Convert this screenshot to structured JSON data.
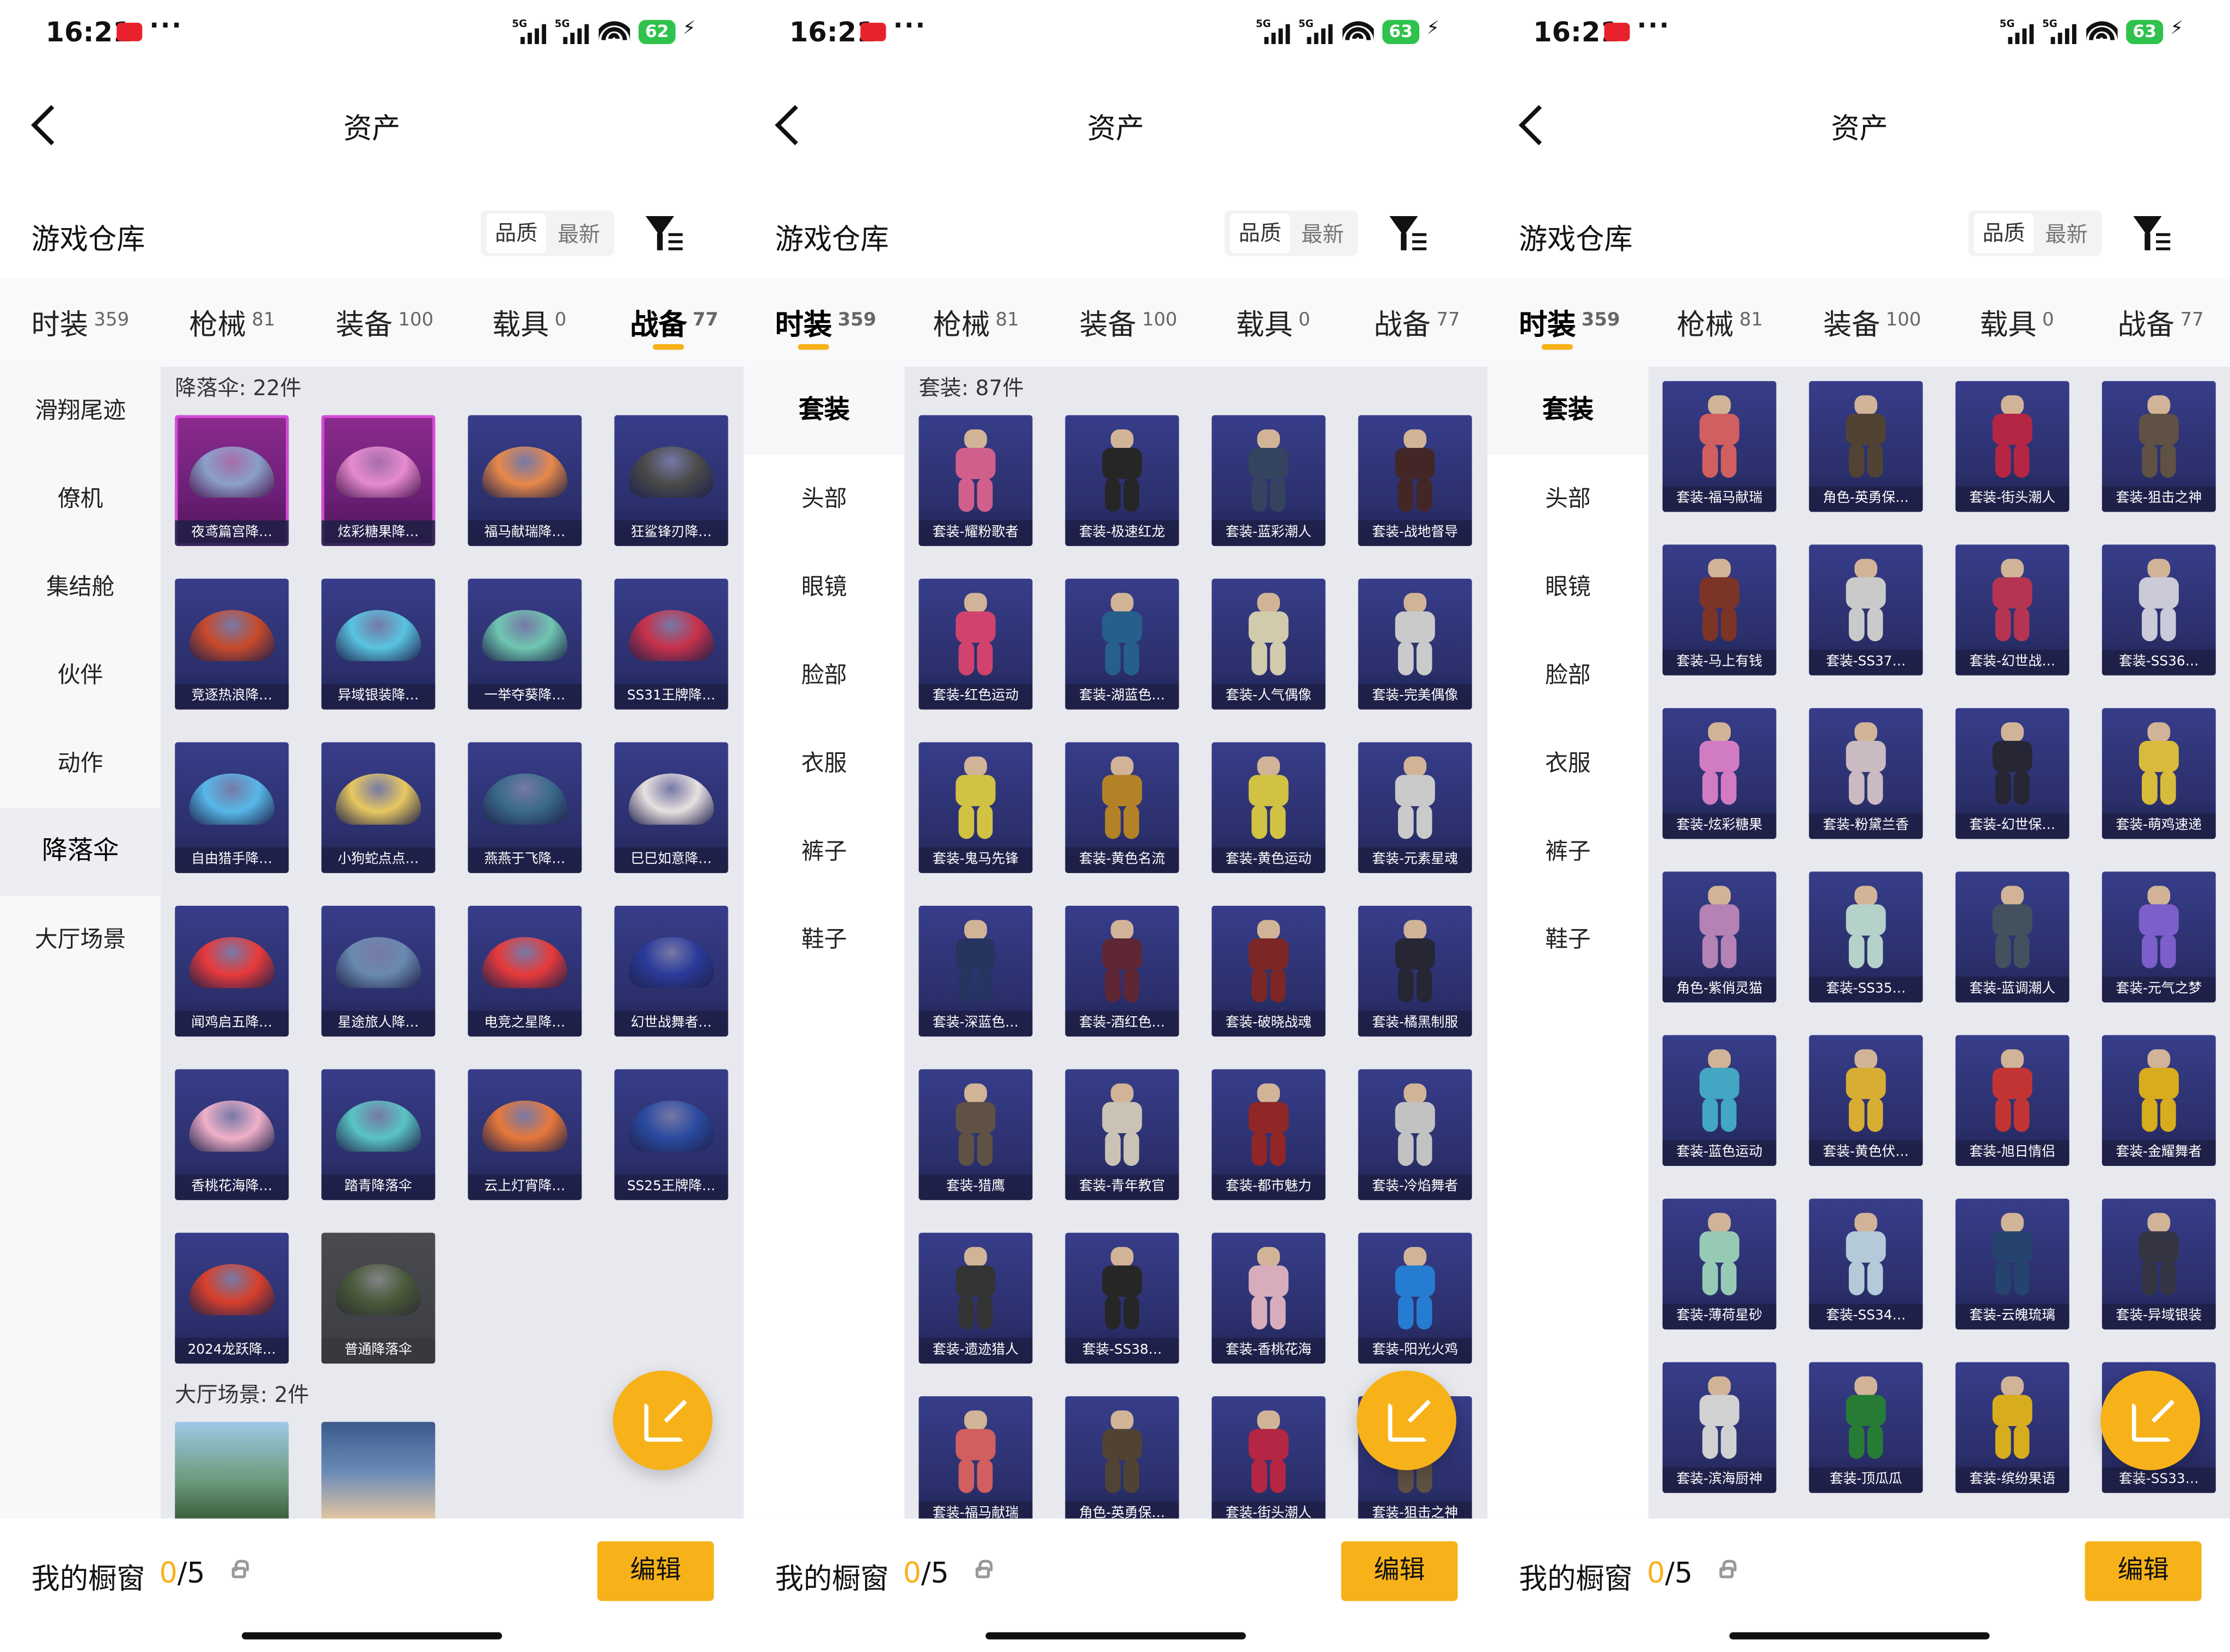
{
  "status": {
    "time": "16:21",
    "dots": "···",
    "net": "5G",
    "batteries": [
      "62",
      "63",
      "63"
    ]
  },
  "nav": {
    "title": "资产"
  },
  "warehouse": {
    "title": "游戏仓库",
    "sort_quality": "品质",
    "sort_newest": "最新"
  },
  "tabs": [
    {
      "label": "时装",
      "count": "359"
    },
    {
      "label": "枪械",
      "count": "81"
    },
    {
      "label": "装备",
      "count": "100"
    },
    {
      "label": "载具",
      "count": "0"
    },
    {
      "label": "战备",
      "count": "77"
    }
  ],
  "panel1": {
    "active_tab": 4,
    "sidebar": [
      "滑翔尾迹",
      "僚机",
      "集结舱",
      "伙伴",
      "动作",
      "降落伞",
      "大厅场景"
    ],
    "active_side": 5,
    "section1": "降落伞: 22件",
    "section2": "大厅场景: 2件",
    "items": [
      "夜鸢篇宫降…",
      "炫彩糖果降…",
      "福马献瑞降…",
      "狂鲨锋刃降…",
      "竞逐热浪降…",
      "异域银装降…",
      "一举夺葵降…",
      "SS31王牌降…",
      "自由猎手降…",
      "小狗蛇点点…",
      "燕燕于飞降…",
      "巳巳如意降…",
      "闻鸡启五降…",
      "星途旅人降…",
      "电竞之星降…",
      "幻世战舞者…",
      "香桃花海降…",
      "踏青降落伞",
      "云上灯宵降…",
      "SS25王牌降…",
      "2024龙跃降…",
      "普通降落伞"
    ],
    "item_colors": [
      "#8aa0c8",
      "#e68bd0",
      "#e8884a",
      "#4a4a48",
      "#c84a2a",
      "#59c4e0",
      "#6fc7b0",
      "#c8314a",
      "#57b8e8",
      "#e8c860",
      "#3a6a8a",
      "#e8e0e0",
      "#e83a3a",
      "#6a8ab0",
      "#e83a3a",
      "#2a3a9a",
      "#f0b0c8",
      "#59c4c4",
      "#e8783a",
      "#2a4aa0",
      "#d8402a",
      "#4a5a3a"
    ],
    "item_icons": [
      "parachute-icon"
    ],
    "lobby_count": 2
  },
  "panel2": {
    "active_tab": 0,
    "sidebar": [
      "套装",
      "头部",
      "眼镜",
      "脸部",
      "衣服",
      "裤子",
      "鞋子"
    ],
    "active_side": 0,
    "section1": "套装: 87件",
    "items": [
      "套装-耀粉歌者",
      "套装-极速红龙",
      "套装-蓝彩潮人",
      "套装-战地督导",
      "套装-红色运动",
      "套装-湖蓝色…",
      "套装-人气偶像",
      "套装-完美偶像",
      "套装-鬼马先锋",
      "套装-黄色名流",
      "套装-黄色运动",
      "套装-元素星魂",
      "套装-深蓝色…",
      "套装-酒红色…",
      "套装-破晓战魂",
      "套装-橘黑制服",
      "套装-猎鹰",
      "套装-青年教官",
      "套装-都市魅力",
      "套装-冷焰舞者",
      "套装-遗迹猎人",
      "套装-SS38…",
      "套装-香桃花海",
      "套装-阳光火鸡",
      "套装-福马献瑞",
      "角色-英勇保…",
      "套装-街头潮人",
      "套装-狙击之神"
    ],
    "item_colors": [
      "#e86a9a",
      "#2a2a2a",
      "#3a4a6a",
      "#4a2a2a",
      "#e84a7a",
      "#2a6a9a",
      "#e8e0c0",
      "#e0e0e0",
      "#e8d84a",
      "#c8902a",
      "#e8d84a",
      "#e0e0e0",
      "#2a3a6a",
      "#6a2a3a",
      "#8a2a2a",
      "#2a2a3a",
      "#6a5a4a",
      "#e0d8c8",
      "#a02a2a",
      "#d8d8d8",
      "#3a3a3a",
      "#2a2a2a",
      "#f0c0d0",
      "#2a8ae8",
      "#e86a6a",
      "#5a4a3a",
      "#c82a4a",
      "#6a5a4a"
    ]
  },
  "panel3": {
    "active_tab": 0,
    "sidebar": [
      "套装",
      "头部",
      "眼镜",
      "脸部",
      "衣服",
      "裤子",
      "鞋子"
    ],
    "active_side": 0,
    "items": [
      "套装-福马献瑞",
      "角色-英勇保…",
      "套装-街头潮人",
      "套装-狙击之神",
      "套装-马上有钱",
      "套装-SS37…",
      "套装-幻世战…",
      "套装-SS36…",
      "套装-炫彩糖果",
      "套装-粉黛兰香",
      "套装-幻世保…",
      "套装-萌鸡速递",
      "角色-紫俏灵猫",
      "套装-SS35…",
      "套装-蓝调潮人",
      "套装-元气之梦",
      "套装-蓝色运动",
      "套装-黄色伏…",
      "套装-旭日情侣",
      "套装-金耀舞者",
      "套装-薄荷星砂",
      "套装-SS34…",
      "套装-云魄琉璃",
      "套装-异域银装",
      "套装-滨海厨神",
      "套装-顶瓜瓜",
      "套装-缤纷果语",
      "套装-SS33…"
    ],
    "item_colors": [
      "#e86a6a",
      "#5a4a3a",
      "#c82a4a",
      "#6a5a4a",
      "#8a3a2a",
      "#e0e0e0",
      "#c83a5a",
      "#e0e0f0",
      "#e88ad8",
      "#e0d0d8",
      "#2a2a3a",
      "#f0d040",
      "#c890c8",
      "#c8e8e0",
      "#4a5a6a",
      "#8a6ae0",
      "#4ab8d8",
      "#f0c03a",
      "#d83a3a",
      "#f0c020",
      "#a8e0c8",
      "#c8e0f0",
      "#2a4a7a",
      "#3a3a4a",
      "#e8e8e8",
      "#2a8a3a",
      "#f0c020",
      "#5a5a7a"
    ]
  },
  "showcase": {
    "label": "我的橱窗",
    "current": "0",
    "total": "/5",
    "edit": "编辑"
  }
}
